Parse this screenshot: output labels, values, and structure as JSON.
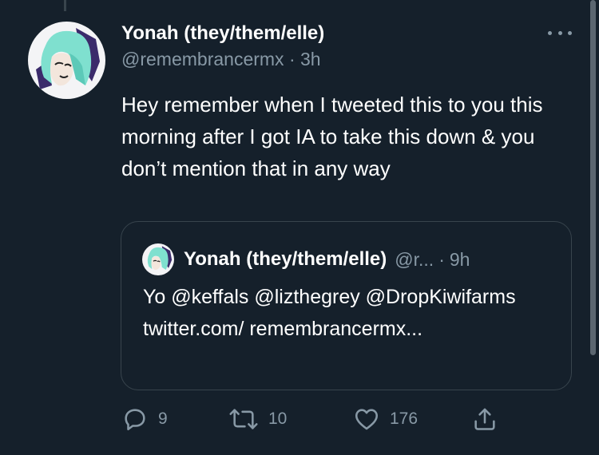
{
  "tweet": {
    "display_name": "Yonah (they/them/elle)",
    "handle": "@remembrancermx",
    "separator": "·",
    "time": "3h",
    "text": "Hey remember when I tweeted this to you this morning after I got IA to take this down & you don’t mention that in any way"
  },
  "quoted_tweet": {
    "display_name": "Yonah (they/them/elle)",
    "handle": "@r...",
    "separator": "·",
    "time": "9h",
    "text": "Yo @keffals @lizthegrey @DropKiwifarms twitter.com/ remembrancermx..."
  },
  "actions": {
    "replies": "9",
    "retweets": "10",
    "likes": "176"
  },
  "icons": {
    "reply": "reply-icon",
    "retweet": "retweet-icon",
    "like": "heart-icon",
    "share": "share-icon",
    "more": "more-icon"
  },
  "colors": {
    "background": "#15202b",
    "secondary_text": "#8899a6",
    "border": "#38444d",
    "primary_text": "#ffffff"
  }
}
